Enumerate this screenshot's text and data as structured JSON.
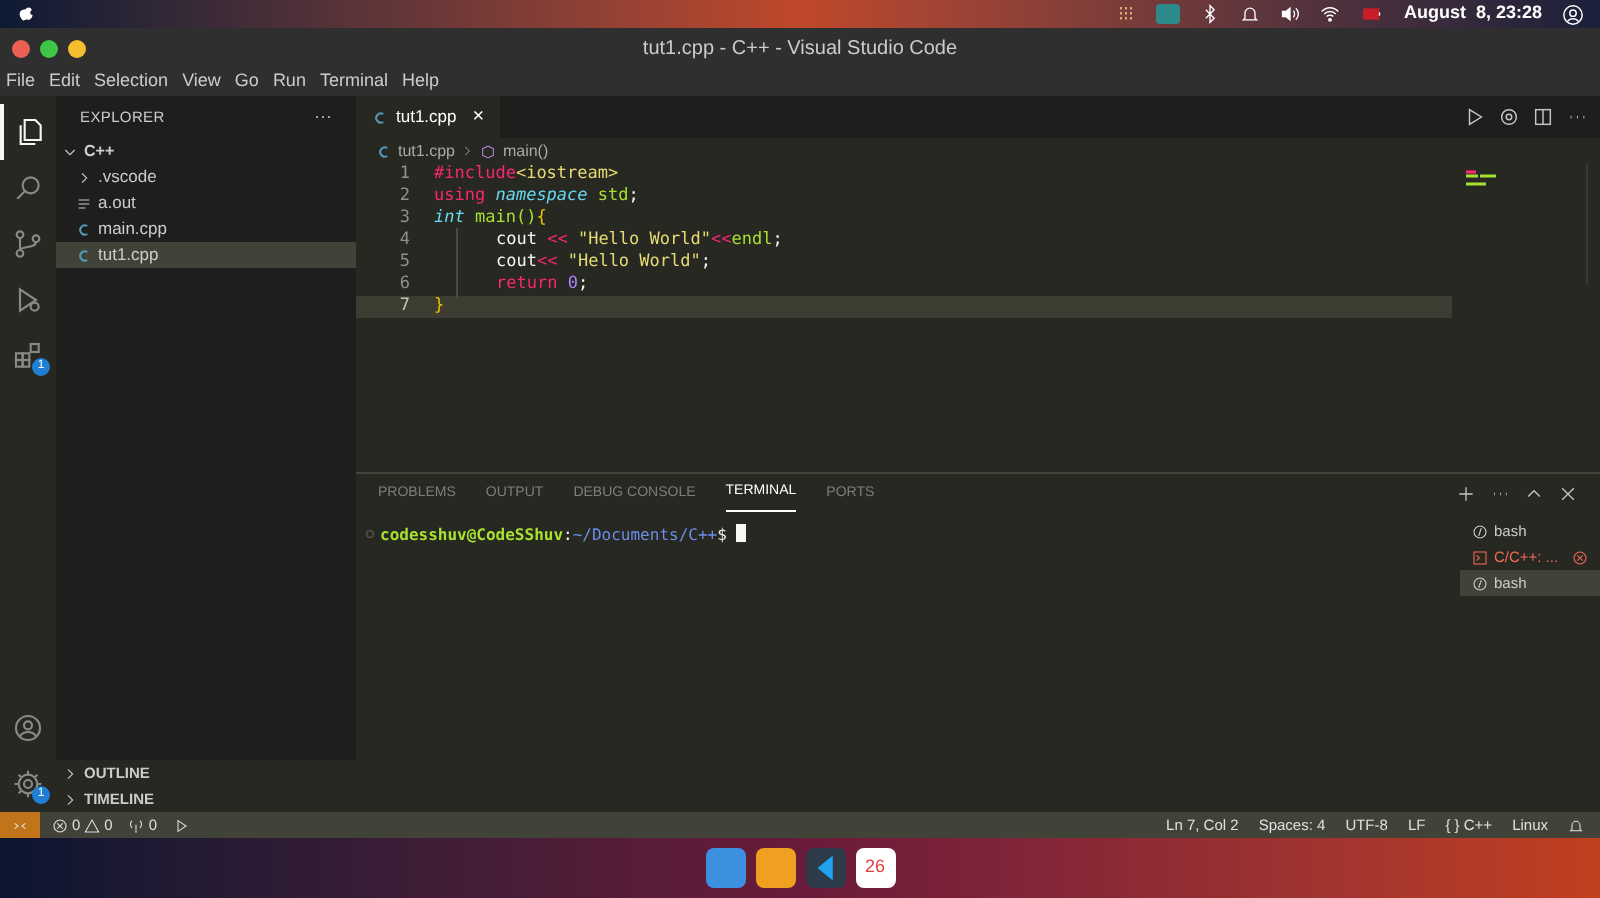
{
  "top_bar": {
    "clock": "August  8, 23:28"
  },
  "window": {
    "title": "tut1.cpp - C++ - Visual Studio Code"
  },
  "menu": [
    "File",
    "Edit",
    "Selection",
    "View",
    "Go",
    "Run",
    "Terminal",
    "Help"
  ],
  "activity_bar": [
    {
      "kind": "explorer",
      "selected": true
    },
    {
      "kind": "search",
      "selected": false
    },
    {
      "kind": "source-control",
      "selected": false
    },
    {
      "kind": "run",
      "selected": false
    },
    {
      "kind": "extensions",
      "selected": false,
      "badge": "1"
    }
  ],
  "activity_bottom": [
    {
      "kind": "account"
    },
    {
      "kind": "settings",
      "badge": "1"
    }
  ],
  "sidebar": {
    "title": "EXPLORER",
    "more": "···",
    "folder": {
      "label": "C++",
      "expanded": true,
      "children": [
        {
          "label": ".vscode",
          "kind": "folder",
          "selected": false
        },
        {
          "label": "a.out",
          "kind": "binary",
          "selected": false
        },
        {
          "label": "main.cpp",
          "kind": "cpp",
          "selected": false
        },
        {
          "label": "tut1.cpp",
          "kind": "cpp",
          "selected": true
        }
      ]
    },
    "sections": [
      {
        "label": "OUTLINE",
        "expanded": false
      },
      {
        "label": "TIMELINE",
        "expanded": false
      }
    ]
  },
  "editor": {
    "tabs": [
      {
        "label": "tut1.cpp",
        "selected": true,
        "close": "×"
      }
    ],
    "breadcrumbs": [
      "tut1.cpp",
      "main()"
    ],
    "lines": [
      {
        "number": "1",
        "indented": false,
        "current": false,
        "tokens": [
          {
            "text": "#include",
            "kind": "keyword"
          },
          {
            "text": "<iostream>",
            "kind": "string"
          }
        ]
      },
      {
        "number": "2",
        "indented": false,
        "current": false,
        "tokens": [
          {
            "text": "using ",
            "kind": "keyword"
          },
          {
            "text": "namespace ",
            "kind": "type"
          },
          {
            "text": "std",
            "kind": "name"
          },
          {
            "text": ";",
            "kind": "plain"
          }
        ]
      },
      {
        "number": "3",
        "indented": false,
        "current": false,
        "tokens": [
          {
            "text": "int ",
            "kind": "type"
          },
          {
            "text": "main()",
            "kind": "name"
          },
          {
            "text": "{",
            "kind": "bracket"
          }
        ]
      },
      {
        "number": "4",
        "indented": true,
        "current": false,
        "tokens": [
          {
            "text": "cout ",
            "kind": "plain"
          },
          {
            "text": "<< ",
            "kind": "keyword"
          },
          {
            "text": "\"Hello World\"",
            "kind": "string"
          },
          {
            "text": "<<",
            "kind": "keyword"
          },
          {
            "text": "endl",
            "kind": "name"
          },
          {
            "text": ";",
            "kind": "plain"
          }
        ]
      },
      {
        "number": "5",
        "indented": true,
        "current": false,
        "tokens": [
          {
            "text": "cout",
            "kind": "plain"
          },
          {
            "text": "<< ",
            "kind": "keyword"
          },
          {
            "text": "\"Hello World\"",
            "kind": "string"
          },
          {
            "text": ";",
            "kind": "plain"
          }
        ]
      },
      {
        "number": "6",
        "indented": true,
        "current": false,
        "tokens": [
          {
            "text": "return ",
            "kind": "keyword"
          },
          {
            "text": "0",
            "kind": "number"
          },
          {
            "text": ";",
            "kind": "plain"
          }
        ]
      },
      {
        "number": "7",
        "indented": false,
        "current": true,
        "tokens": [
          {
            "text": "}",
            "kind": "bracket"
          }
        ]
      }
    ]
  },
  "panel": {
    "tabs": [
      {
        "label": "PROBLEMS",
        "selected": false
      },
      {
        "label": "OUTPUT",
        "selected": false
      },
      {
        "label": "DEBUG CONSOLE",
        "selected": false
      },
      {
        "label": "TERMINAL",
        "selected": true
      },
      {
        "label": "PORTS",
        "selected": false
      }
    ],
    "prompt": [
      {
        "text": "codesshuv@CodeSShuv",
        "kind": "user"
      },
      {
        "text": ":",
        "kind": "plain"
      },
      {
        "text": "~/Documents/C++",
        "kind": "path"
      },
      {
        "text": "$ ",
        "kind": "plain"
      }
    ],
    "terminals": [
      {
        "label": "bash",
        "kind": "shell",
        "selected": false
      },
      {
        "label": "C/C++: ...",
        "kind": "task",
        "selected": false
      },
      {
        "label": "bash",
        "kind": "shell",
        "selected": true
      }
    ]
  },
  "status_bar": {
    "errors": "0",
    "warnings": "0",
    "ports": "0",
    "right": [
      "Ln 7, Col 2",
      "Spaces: 4",
      "UTF-8",
      "LF",
      "{ } C++",
      "Linux"
    ]
  },
  "dock": {
    "calendar_day": "26"
  }
}
